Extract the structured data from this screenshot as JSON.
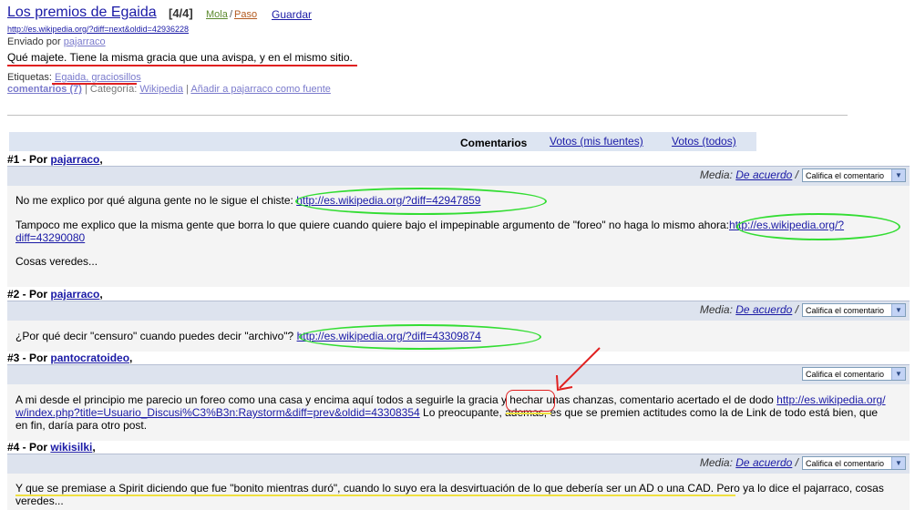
{
  "post": {
    "title": "Los premios de Egaida",
    "count": "[4/4]",
    "mola": "Mola",
    "sep": "/",
    "paso": "Paso",
    "save": "Guardar",
    "source_url": "http://es.wikipedia.org/?diff=next&oldid=42936228",
    "sent_label": "Enviado por",
    "author": "pajarraco",
    "description": "Qué majete. Tiene la misma gracia que una avispa, y en el mismo sitio.",
    "tags_label": "Etiquetas:",
    "tags": "Egaida, graciosillos",
    "comments_link": "comentarios (7)",
    "category_label": "| Categoría:",
    "category": "Wikipedia",
    "meta_sep": "|",
    "add_source": "Añadir a pajarraco como fuente"
  },
  "tabs": {
    "active": "Comentarios",
    "fuentes": "Votos (mis fuentes)",
    "todos": "Votos (todos)"
  },
  "rating": {
    "media_label": "Media:",
    "media_value": "De acuerdo",
    "slash": "/",
    "select": "Califica el comentario",
    "arrow": "▼"
  },
  "comments": [
    {
      "head": "#1 - Por",
      "user": "pajarraco",
      "comma": ",",
      "p1": "No me explico por qué alguna gente no le sigue el chiste:",
      "l1": "http://es.wikipedia.org/?diff=42947859",
      "p2": "Tampoco me explico que la misma gente que borra lo que quiere cuando quiere bajo el impepinable argumento de \"foreo\" no haga lo mismo ahora:",
      "l2a": "http://es.wikipedia.org/?",
      "l2b": "diff=43290080",
      "p3": "Cosas veredes..."
    },
    {
      "head": "#2 - Por",
      "user": "pajarraco",
      "comma": ",",
      "p1": "¿Por qué decir \"censuro\" cuando puedes decir \"archivo\"?",
      "l1": "http://es.wikipedia.org/?diff=43309874"
    },
    {
      "head": "#3 - Por",
      "user": "pantocratoideo",
      "comma": ",",
      "t1": "A mi desde el principio me parecio un foreo como una casa y encima aquí todos a seguirle la gracia y hechar unas chanzas, comentario acertado el de dodo",
      "l1": "http://es.wikipedia.org/",
      "l2": "w/index.php?title=Usuario_Discusi%C3%B3n:Raystorm&diff=prev&oldid=43308354",
      "t2": "Lo preocupante, ademas, es que se premien actitudes como la de Link de todo está bien, que",
      "t3": "en fin, daría para otro post."
    },
    {
      "head": "#4 - Por",
      "user": "wikisilki",
      "comma": ",",
      "t1": "Y que se premiase a Spirit diciendo que fue \"bonito mientras duró\", cuando lo suyo era la desvirtuación de lo que debería ser un AD o una CAD. Pero ya lo dice el pajarraco, cosas",
      "t2": "veredes..."
    }
  ],
  "colors": {
    "link": "#1a1aa6",
    "annotation_green": "#33dd33",
    "annotation_red": "#e02020",
    "annotation_yellow": "#f0e040",
    "rating_bar": "#dde3ee"
  }
}
